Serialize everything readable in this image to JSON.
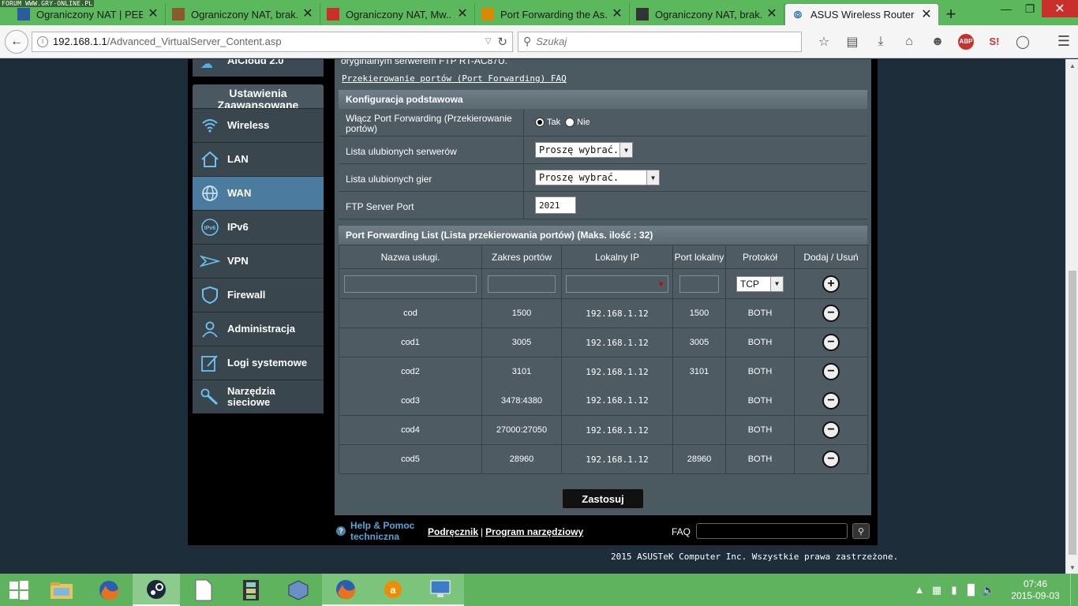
{
  "watermark": "FORUM WWW.GRY-ONLINE.PL",
  "browser": {
    "tabs": [
      {
        "title": "Ograniczony NAT | PEB...",
        "icon": "peb-icon",
        "icon_color": "#2a5d9c",
        "active": false
      },
      {
        "title": "Ograniczony NAT, brak...",
        "icon": "forum-icon",
        "icon_color": "#8a5a2b",
        "active": false
      },
      {
        "title": "Ograniczony NAT, Mw...",
        "icon": "g-icon",
        "icon_color": "#c9302c",
        "active": false
      },
      {
        "title": "Port Forwarding the As...",
        "icon": "pf-icon",
        "icon_color": "#d88a00",
        "active": false
      },
      {
        "title": "Ograniczony NAT, brak...",
        "icon": "mpc-icon",
        "icon_color": "#333333",
        "active": false
      },
      {
        "title": "ASUS Wireless Router R...",
        "icon": "wireless-icon",
        "icon_color": "#2a6fb0",
        "active": true
      }
    ],
    "url_host": "192.168.1.1",
    "url_path": "/Advanced_VirtualServer_Content.asp",
    "search_placeholder": "Szukaj",
    "addon_abp": "ABP",
    "addon_sj": "S!"
  },
  "sidebar": {
    "top_item": "AiCloud 2.0",
    "section_header": "Ustawienia Zaawansowane",
    "items": [
      {
        "label": "Wireless",
        "icon": "wifi-icon",
        "active": false
      },
      {
        "label": "LAN",
        "icon": "home-icon",
        "active": false
      },
      {
        "label": "WAN",
        "icon": "globe-icon",
        "active": true
      },
      {
        "label": "IPv6",
        "icon": "ipv6-icon",
        "active": false
      },
      {
        "label": "VPN",
        "icon": "vpn-icon",
        "active": false
      },
      {
        "label": "Firewall",
        "icon": "shield-icon",
        "active": false
      },
      {
        "label": "Administracja",
        "icon": "user-icon",
        "active": false
      },
      {
        "label": "Logi systemowe",
        "icon": "log-icon",
        "active": false
      },
      {
        "label": "Narzędzia sieciowe",
        "icon": "tools-icon",
        "active": false
      }
    ]
  },
  "content": {
    "intro_text": "oryginalnym serwerem FTP RT-AC87U.",
    "faq_link": "Przekierowanie portów (Port Forwarding) FAQ",
    "basic": {
      "title": "Konfiguracja podstawowa",
      "enable_label": "Włącz Port Forwarding (Przekierowanie portów)",
      "radio_yes": "Tak",
      "radio_no": "Nie",
      "servers_label": "Lista ulubionych serwerów",
      "servers_value": "Proszę wybrać.",
      "games_label": "Lista ulubionych gier",
      "games_value": "Proszę wybrać.",
      "ftp_label": "FTP Server Port",
      "ftp_value": "2021"
    },
    "list": {
      "title": "Port Forwarding List (Lista przekierowania portów) (Maks. ilość : 32)",
      "headers": [
        "Nazwa usługi.",
        "Zakres portów",
        "Lokalny IP",
        "Port lokalny",
        "Protokół",
        "Dodaj / Usuń"
      ],
      "new_protocol": "TCP",
      "rows": [
        {
          "name": "cod",
          "range": "1500",
          "ip": "192.168.1.12",
          "local": "1500",
          "proto": "BOTH"
        },
        {
          "name": "cod1",
          "range": "3005",
          "ip": "192.168.1.12",
          "local": "3005",
          "proto": "BOTH"
        },
        {
          "name": "cod2",
          "range": "3101",
          "ip": "192.168.1.12",
          "local": "3101",
          "proto": "BOTH"
        },
        {
          "name": "cod3",
          "range": "3478:4380",
          "ip": "192.168.1.12",
          "local": "",
          "proto": "BOTH"
        },
        {
          "name": "cod4",
          "range": "27000:27050",
          "ip": "192.168.1.12",
          "local": "",
          "proto": "BOTH"
        },
        {
          "name": "cod5",
          "range": "28960",
          "ip": "192.168.1.12",
          "local": "28960",
          "proto": "BOTH"
        }
      ]
    },
    "apply_label": "Zastosuj"
  },
  "footer": {
    "help_line1": "Help & Pomoc",
    "help_line2": "techniczna",
    "manual": "Podręcznik",
    "separator": "|",
    "utility": "Program narzędziowy",
    "faq_label": "FAQ",
    "copyright": "2015 ASUSTeK Computer Inc. Wszystkie prawa zastrzeżone."
  },
  "taskbar": {
    "time": "07:46",
    "date": "2015-09-03"
  }
}
